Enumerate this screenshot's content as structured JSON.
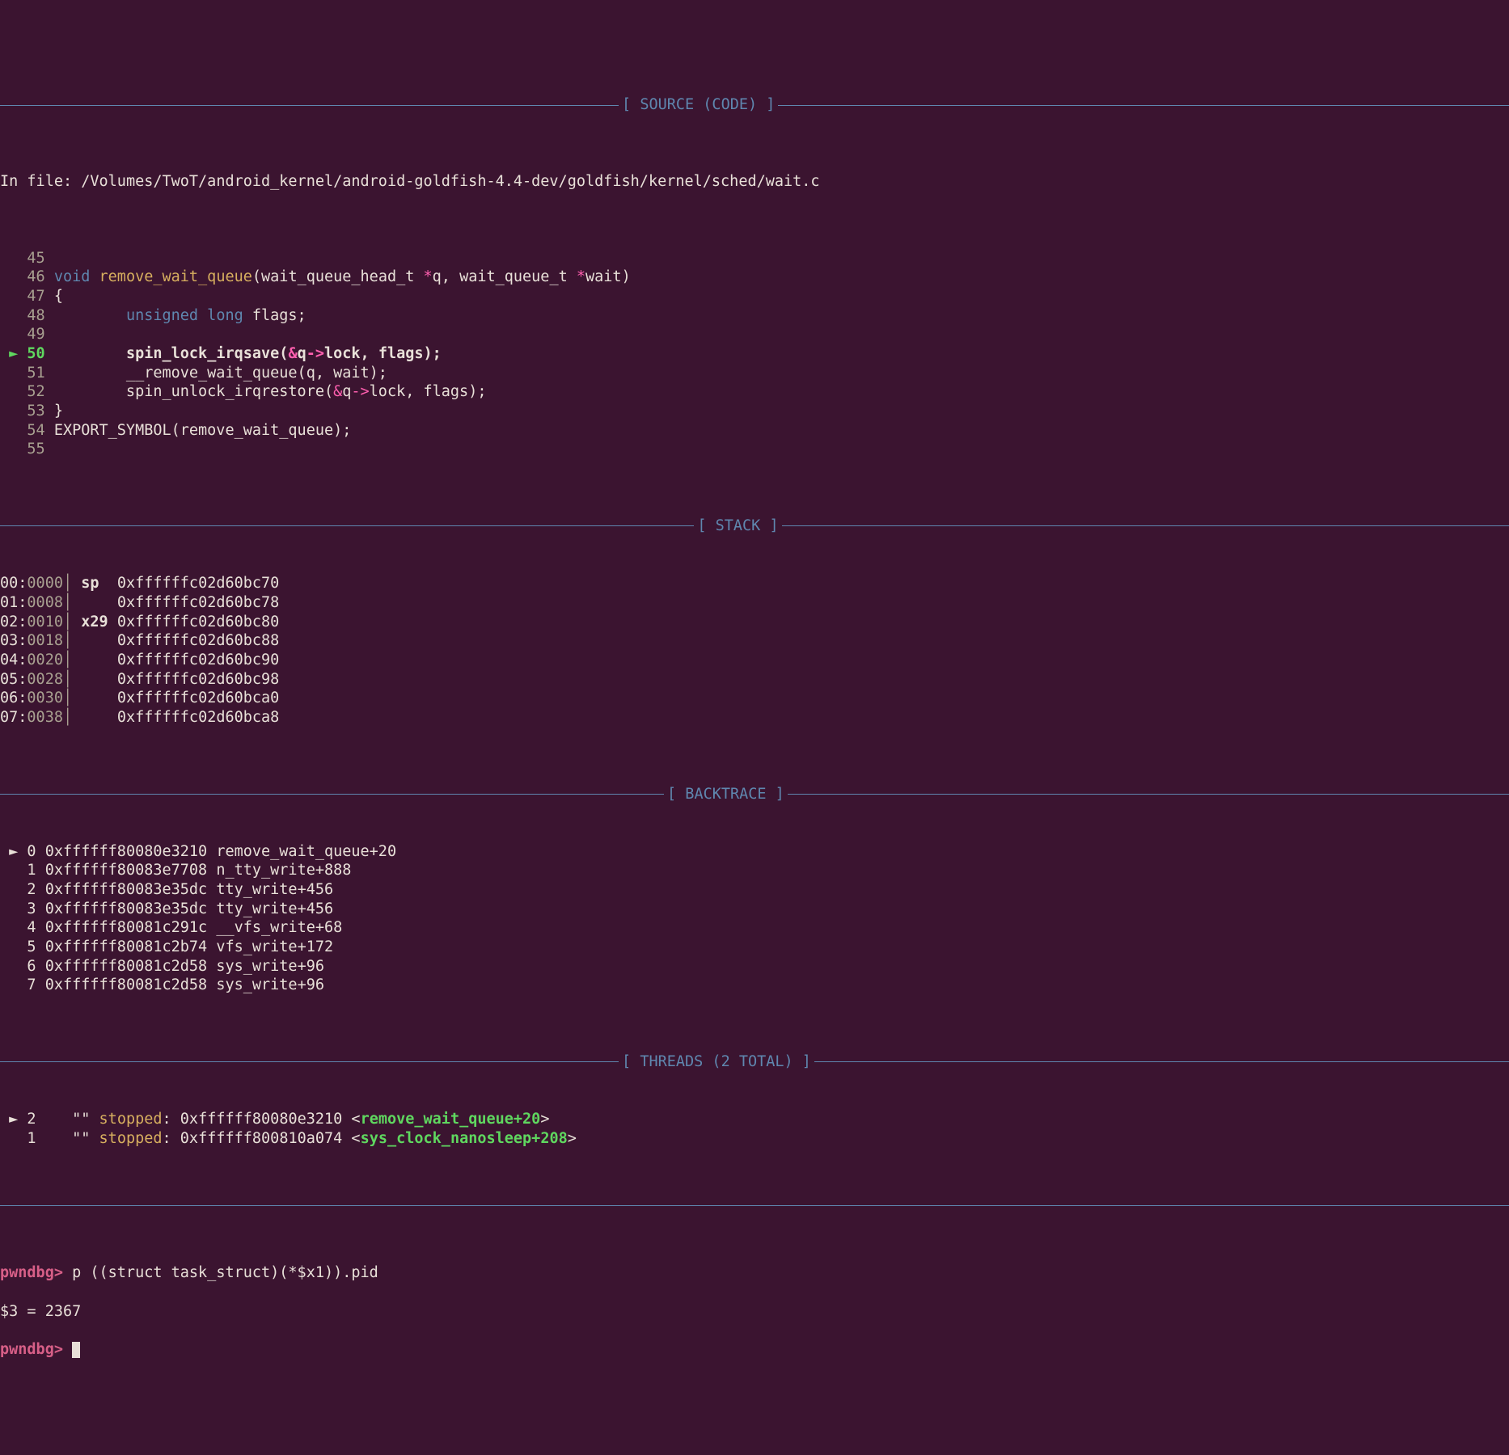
{
  "sections": {
    "source": "[ SOURCE (CODE) ]",
    "stack": "[ STACK ]",
    "backtrace": "[ BACKTRACE ]",
    "threads": "[ THREADS (2 TOTAL) ]"
  },
  "source": {
    "file_prefix": "In file: ",
    "file_path": "/Volumes/TwoT/android_kernel/android-goldfish-4.4-dev/goldfish/kernel/sched/wait.c",
    "lines": [
      {
        "n": "45",
        "parts": []
      },
      {
        "n": "46",
        "parts": [
          {
            "t": "void ",
            "c": "blue"
          },
          {
            "t": "remove_wait_queue",
            "c": "yellow"
          },
          {
            "t": "(wait_queue_head_t ",
            "c": "white"
          },
          {
            "t": "*",
            "c": "pink"
          },
          {
            "t": "q, wait_queue_t ",
            "c": "white"
          },
          {
            "t": "*",
            "c": "pink"
          },
          {
            "t": "wait)",
            "c": "white"
          }
        ]
      },
      {
        "n": "47",
        "parts": [
          {
            "t": "{",
            "c": "white"
          }
        ]
      },
      {
        "n": "48",
        "parts": [
          {
            "t": "        ",
            "c": "white"
          },
          {
            "t": "unsigned long",
            "c": "blue"
          },
          {
            "t": " flags;",
            "c": "white"
          }
        ]
      },
      {
        "n": "49",
        "parts": []
      },
      {
        "n": "50",
        "current": true,
        "parts": [
          {
            "t": "        spin_lock_irqsave(",
            "c": "bold"
          },
          {
            "t": "&",
            "c": "pink bold"
          },
          {
            "t": "q",
            "c": "bold"
          },
          {
            "t": "->",
            "c": "pink bold"
          },
          {
            "t": "lock, flags);",
            "c": "bold"
          }
        ]
      },
      {
        "n": "51",
        "parts": [
          {
            "t": "        __remove_wait_queue(q, wait);",
            "c": "white"
          }
        ]
      },
      {
        "n": "52",
        "parts": [
          {
            "t": "        spin_unlock_irqrestore(",
            "c": "white"
          },
          {
            "t": "&",
            "c": "pink"
          },
          {
            "t": "q",
            "c": "white"
          },
          {
            "t": "->",
            "c": "pink"
          },
          {
            "t": "lock, flags);",
            "c": "white"
          }
        ]
      },
      {
        "n": "53",
        "parts": [
          {
            "t": "}",
            "c": "white"
          }
        ]
      },
      {
        "n": "54",
        "parts": [
          {
            "t": "EXPORT_SYMBOL(remove_wait_queue);",
            "c": "white"
          }
        ]
      },
      {
        "n": "55",
        "parts": []
      }
    ]
  },
  "stack": [
    {
      "off": "00:",
      "idx": "0000",
      "reg": "sp ",
      "addr": "0xffffffc02d60bc70"
    },
    {
      "off": "01:",
      "idx": "0008",
      "reg": "   ",
      "addr": "0xffffffc02d60bc78"
    },
    {
      "off": "02:",
      "idx": "0010",
      "reg": "x29",
      "addr": "0xffffffc02d60bc80"
    },
    {
      "off": "03:",
      "idx": "0018",
      "reg": "   ",
      "addr": "0xffffffc02d60bc88"
    },
    {
      "off": "04:",
      "idx": "0020",
      "reg": "   ",
      "addr": "0xffffffc02d60bc90"
    },
    {
      "off": "05:",
      "idx": "0028",
      "reg": "   ",
      "addr": "0xffffffc02d60bc98"
    },
    {
      "off": "06:",
      "idx": "0030",
      "reg": "   ",
      "addr": "0xffffffc02d60bca0"
    },
    {
      "off": "07:",
      "idx": "0038",
      "reg": "   ",
      "addr": "0xffffffc02d60bca8"
    }
  ],
  "backtrace": [
    {
      "sel": true,
      "i": "0",
      "addr": "0xffffff80080e3210",
      "sym": "remove_wait_queue+20"
    },
    {
      "sel": false,
      "i": "1",
      "addr": "0xffffff80083e7708",
      "sym": "n_tty_write+888"
    },
    {
      "sel": false,
      "i": "2",
      "addr": "0xffffff80083e35dc",
      "sym": "tty_write+456"
    },
    {
      "sel": false,
      "i": "3",
      "addr": "0xffffff80083e35dc",
      "sym": "tty_write+456"
    },
    {
      "sel": false,
      "i": "4",
      "addr": "0xffffff80081c291c",
      "sym": "__vfs_write+68"
    },
    {
      "sel": false,
      "i": "5",
      "addr": "0xffffff80081c2b74",
      "sym": "vfs_write+172"
    },
    {
      "sel": false,
      "i": "6",
      "addr": "0xffffff80081c2d58",
      "sym": "sys_write+96"
    },
    {
      "sel": false,
      "i": "7",
      "addr": "0xffffff80081c2d58",
      "sym": "sys_write+96"
    }
  ],
  "threads": [
    {
      "sel": true,
      "id": "2",
      "name": "\"\"",
      "state": "stopped",
      "addr": "0xffffff80080e3210",
      "sym": "remove_wait_queue+20"
    },
    {
      "sel": false,
      "id": "1",
      "name": "\"\"",
      "state": "stopped",
      "addr": "0xffffff800810a074",
      "sym": "sys_clock_nanosleep+208"
    }
  ],
  "prompt": {
    "label": "pwndbg>",
    "cmd1": "p ((struct task_struct)(*$x1)).pid",
    "out1": "$3 = 2367"
  }
}
